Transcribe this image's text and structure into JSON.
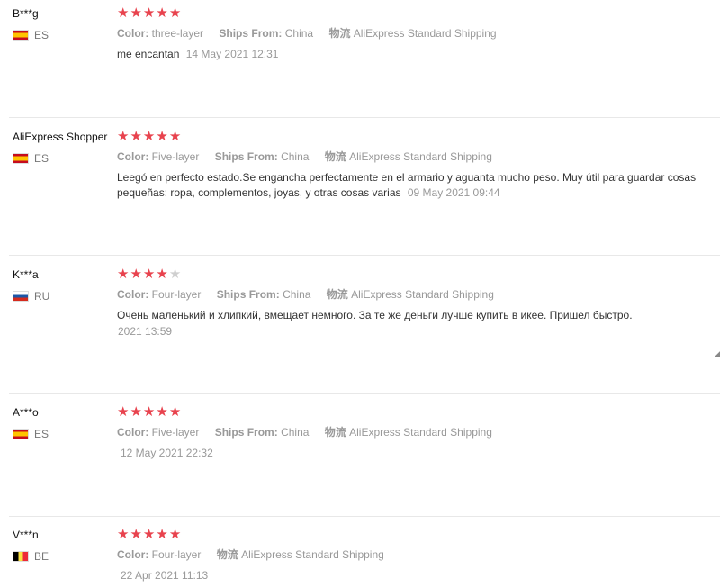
{
  "reviews": [
    {
      "user": "B***g",
      "country": "ES",
      "stars": 5,
      "color_label": "Color:",
      "color_value": "three-layer",
      "ships_label": "Ships From:",
      "ships_value": "China",
      "logistics_label": "物流",
      "logistics_value": "AliExpress Standard Shipping",
      "text": "me encantan",
      "date": "14 May 2021 12:31"
    },
    {
      "user": "AliExpress Shopper",
      "country": "ES",
      "stars": 5,
      "color_label": "Color:",
      "color_value": "Five-layer",
      "ships_label": "Ships From:",
      "ships_value": "China",
      "logistics_label": "物流",
      "logistics_value": "AliExpress Standard Shipping",
      "text": "Leegó en perfecto estado.Se engancha perfectamente en el armario y aguanta mucho peso. Muy útil para guardar cosas pequeñas: ropa, complementos, joyas, y otras cosas varias",
      "date": "09 May 2021 09:44"
    },
    {
      "user": "K***a",
      "country": "RU",
      "stars": 4,
      "color_label": "Color:",
      "color_value": "Four-layer",
      "ships_label": "Ships From:",
      "ships_value": "China",
      "logistics_label": "物流",
      "logistics_value": "AliExpress Standard Shipping",
      "text": "Очень маленький и хлипкий, вмещает немного. За те же деньги лучше купить в икее. Пришел быстро.",
      "date": "2021 13:59"
    },
    {
      "user": "A***o",
      "country": "ES",
      "stars": 5,
      "color_label": "Color:",
      "color_value": "Five-layer",
      "ships_label": "Ships From:",
      "ships_value": "China",
      "logistics_label": "物流",
      "logistics_value": "AliExpress Standard Shipping",
      "date": "12 May 2021 22:32"
    },
    {
      "user": "V***n",
      "country": "BE",
      "stars": 5,
      "color_label": "Color:",
      "color_value": "Four-layer",
      "logistics_label": "物流",
      "logistics_value": "AliExpress Standard Shipping",
      "date": "22 Apr 2021 11:13"
    }
  ],
  "colors": {
    "star_active": "#e8434e",
    "star_inactive": "#cfcfcf",
    "meta_text": "#999999"
  }
}
